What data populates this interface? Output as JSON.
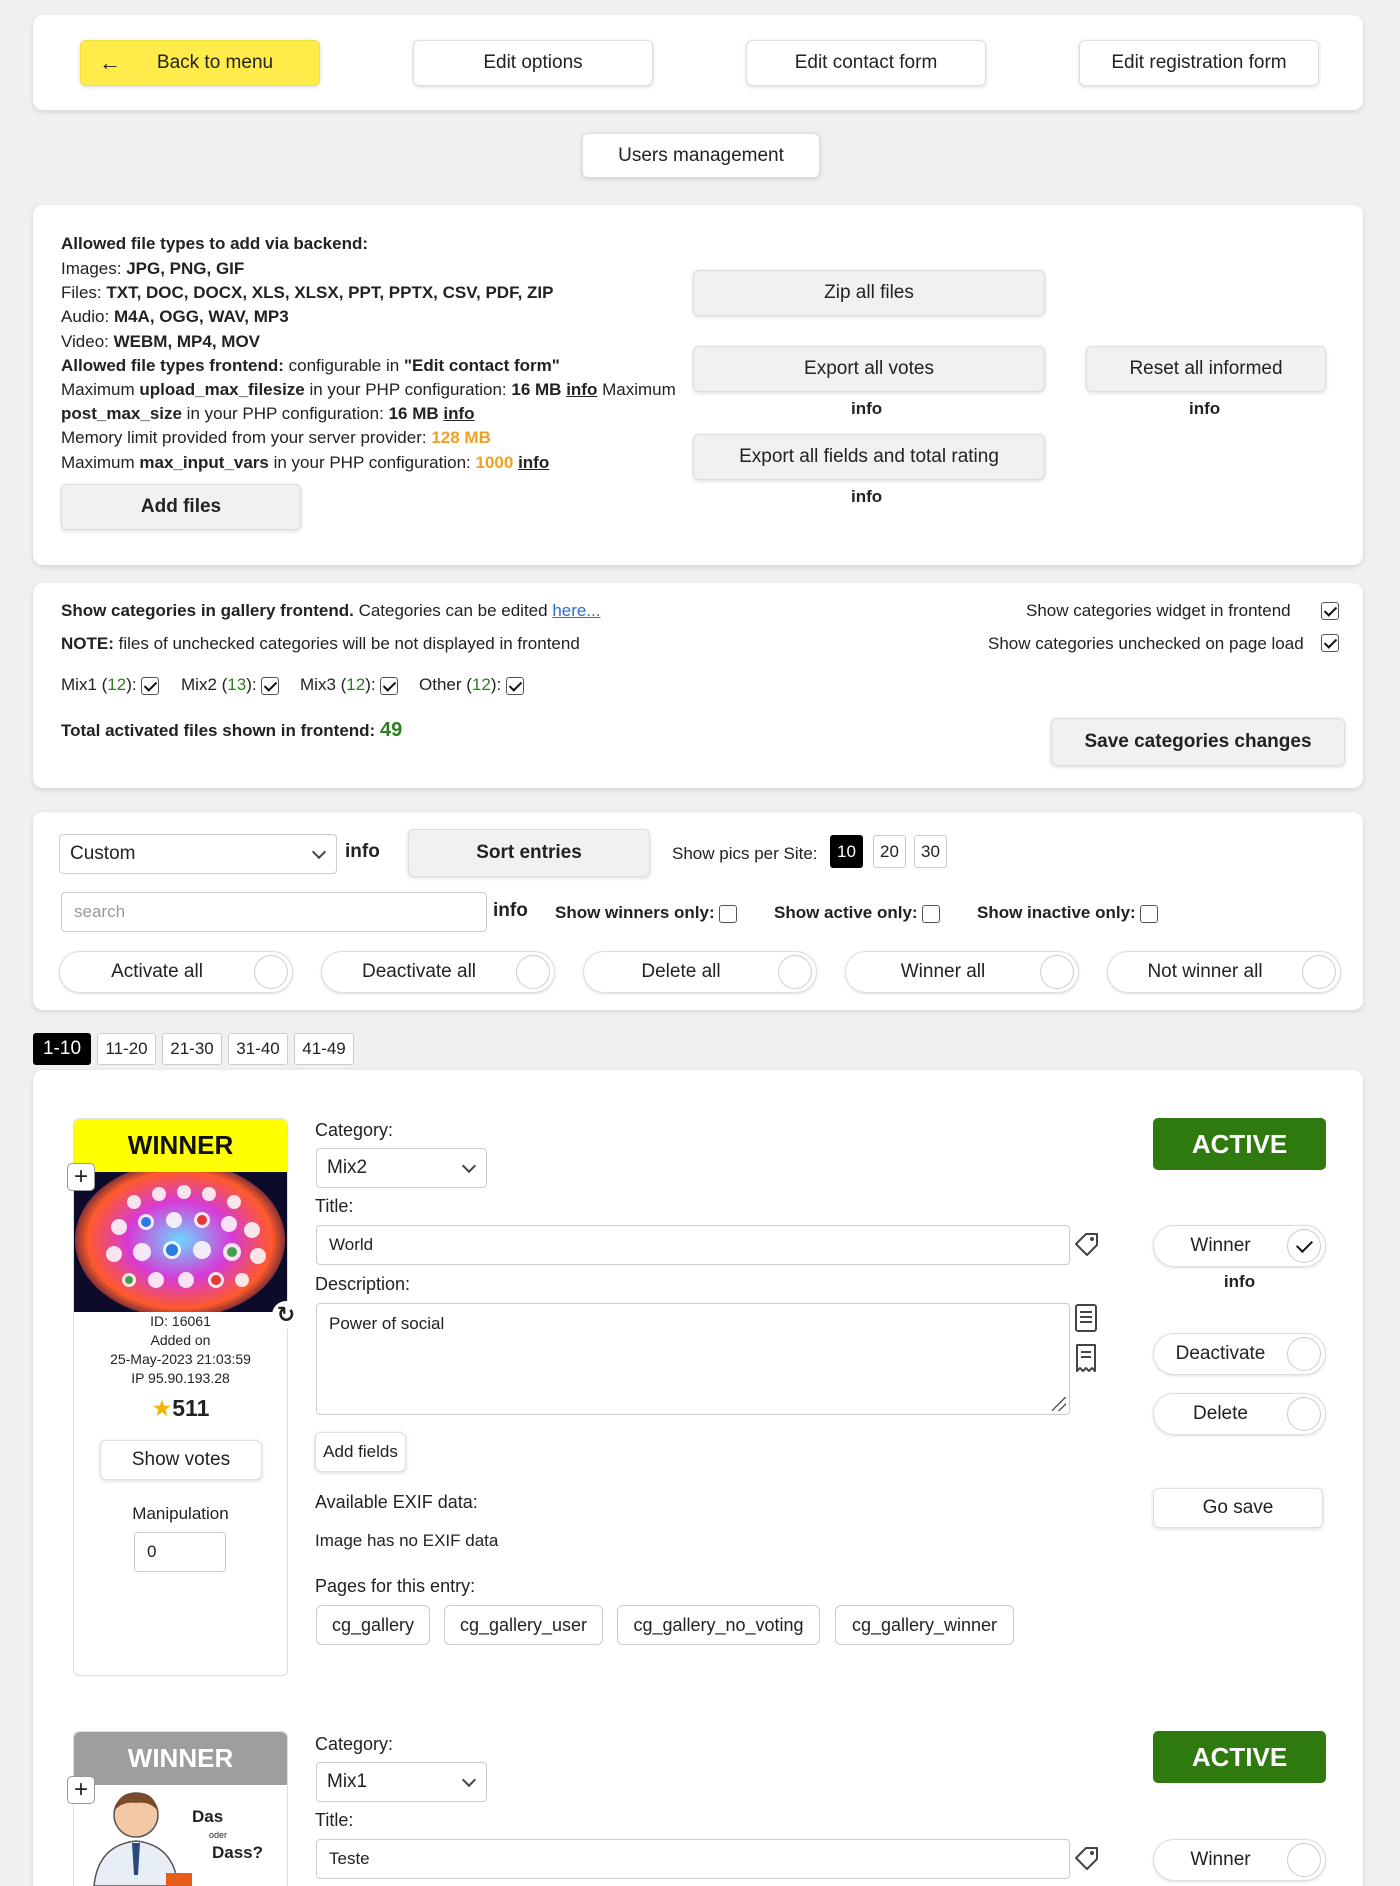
{
  "nav": {
    "back": "Back to menu",
    "edit_options": "Edit options",
    "edit_contact": "Edit contact form",
    "edit_registration": "Edit registration form",
    "users_management": "Users management"
  },
  "files": {
    "allowed_backend": "Allowed file types to add via backend:",
    "images_label": "Images: ",
    "images": "JPG, PNG, GIF",
    "files_label": "Files: ",
    "files": "TXT, DOC, DOCX, XLS, XLSX, PPT, PPTX, CSV, PDF, ZIP",
    "audio_label": "Audio: ",
    "audio": "M4A, OGG, WAV, MP3",
    "video_label": "Video: ",
    "video": "WEBM, MP4, MOV",
    "allowed_frontend": "Allowed file types frontend:",
    "frontend_text": " configurable in ",
    "frontend_form": "\"Edit contact form\"",
    "max_label": "Maximum ",
    "upload_key": "upload_max_filesize",
    "in_php": " in your PHP configuration: ",
    "upload_val": "16 MB",
    "info": "info",
    "maximum_word": " Maximum",
    "post_key": "post_max_size",
    "post_val": "16 MB",
    "memory_label": "Memory limit provided from your server provider: ",
    "memory_val": "128 MB",
    "input_key": "max_input_vars",
    "input_val": "1000",
    "add_files": "Add files",
    "zip_all": "Zip all files",
    "export_votes": "Export all votes",
    "reset_informed": "Reset all informed",
    "export_fields": "Export all fields and total rating"
  },
  "categories": {
    "show_label": "Show categories in gallery frontend.",
    "edit_text": " Categories can be edited ",
    "here": "here...",
    "note_label": "NOTE:",
    "note_text": " files of unchecked categories will be not displayed in frontend",
    "widget": "Show categories widget in frontend",
    "unchecked": "Show categories unchecked on page load",
    "items": [
      {
        "name": "Mix1",
        "count": "12"
      },
      {
        "name": "Mix2",
        "count": "13"
      },
      {
        "name": "Mix3",
        "count": "12"
      },
      {
        "name": "Other",
        "count": "12"
      }
    ],
    "total_label": "Total activated files shown in frontend:",
    "total": "49",
    "save": "Save categories changes"
  },
  "controls": {
    "sort_select": "Custom",
    "info": "info",
    "sort_entries": "Sort entries",
    "per_site_label": "Show pics per Site:",
    "per_site": [
      "10",
      "20",
      "30"
    ],
    "search_placeholder": "search",
    "winners_only": "Show winners only:",
    "active_only": "Show active only:",
    "inactive_only": "Show inactive only:",
    "activate_all": "Activate all",
    "deactivate_all": "Deactivate all",
    "delete_all": "Delete all",
    "winner_all": "Winner all",
    "not_winner_all": "Not winner all"
  },
  "pagination": [
    "1-10",
    "11-20",
    "21-30",
    "31-40",
    "41-49"
  ],
  "entries": [
    {
      "winner_label": "WINNER",
      "id": "ID: 16061",
      "added_on": "Added on",
      "date": "25-May-2023 21:03:59",
      "ip": "IP 95.90.193.28",
      "rating": "511",
      "show_votes": "Show votes",
      "manipulation_label": "Manipulation",
      "manipulation": "0",
      "category_label": "Category:",
      "category": "Mix2",
      "title_label": "Title:",
      "title": "World",
      "description_label": "Description:",
      "description": "Power of social",
      "add_fields": "Add fields",
      "exif_label": "Available EXIF data:",
      "exif": "Image has no EXIF data",
      "pages_label": "Pages for this entry:",
      "pages": [
        "cg_gallery",
        "cg_gallery_user",
        "cg_gallery_no_voting",
        "cg_gallery_winner"
      ],
      "status": "ACTIVE",
      "winner_btn": "Winner",
      "info": "info",
      "deactivate": "Deactivate",
      "delete": "Delete",
      "go_save": "Go save"
    },
    {
      "winner_label": "WINNER",
      "image_text_1": "Das",
      "image_text_2": "oder",
      "image_text_3": "Dass?",
      "category_label": "Category:",
      "category": "Mix1",
      "title_label": "Title:",
      "title": "Teste",
      "status": "ACTIVE",
      "winner_btn": "Winner"
    }
  ],
  "colors": {
    "back_button": "#ffeb4a",
    "winner_yellow": "#ffff00",
    "winner_grey": "#9e9e9e",
    "active_green": "#2f7a0f",
    "orange": "#f0a020",
    "count_green": "#2e7d22"
  }
}
